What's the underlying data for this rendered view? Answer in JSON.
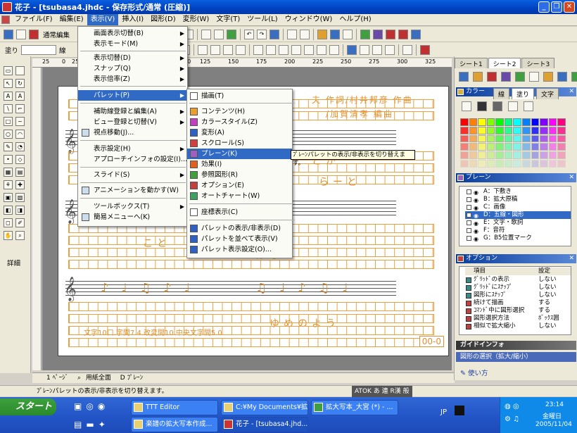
{
  "window": {
    "title": "花子 - [tsubasa4.jhdc - 保存形式/通常 (圧縮)]"
  },
  "menubar": [
    "ファイル(F)",
    "編集(E)",
    "表示(V)",
    "挿入(I)",
    "図形(D)",
    "変形(W)",
    "文字(T)",
    "ツール(L)",
    "ウィンドウ(W)",
    "ヘルプ(H)"
  ],
  "toolbar2": {
    "mode_label": "通常編集",
    "fill_label": "塗り",
    "line_label": "線"
  },
  "view_menu": [
    {
      "label": "画面表示切替(B)",
      "sub": true
    },
    {
      "label": "表示モード(M)",
      "sub": true
    },
    {
      "label": "表示切替(D)",
      "sub": true
    },
    {
      "label": "スナップ(Q)",
      "sub": true
    },
    {
      "label": "表示倍率(Z)",
      "sub": true
    },
    {
      "label": "パレット(P)",
      "sub": true
    },
    {
      "label": "補助線登録と編集(A)",
      "sub": true
    },
    {
      "label": "ビュー登録と切替(V)",
      "sub": true
    },
    {
      "label": "視点移動(J)..."
    },
    {
      "label": "表示設定(H)",
      "sub": true
    },
    {
      "label": "アプローチインフォの設定(I)..."
    },
    {
      "label": "スライド(S)",
      "sub": true
    },
    {
      "label": "アニメーションを動かす(W)"
    },
    {
      "label": "ツールボックス(T)",
      "sub": true
    },
    {
      "label": "簡易メニューへ(K)"
    }
  ],
  "palette_submenu": [
    "描画(T)",
    "コンテンツ(H)",
    "カラースタイル(Z)",
    "変形(A)",
    "スクロール(S)",
    "プレーン(K)",
    "効果(I)",
    "参照図形(R)",
    "オプション(E)",
    "オートチャート(W)",
    "座標表示(C)",
    "パレットの表示/非表示(D)",
    "パレットを並べて表示(V)",
    "パレット表示設定(O)..."
  ],
  "tooltip": "ﾌﾟﾚｰﾝパレットの表示/非表示を切り替えます。",
  "rulers": {
    "top_ticks": [
      "25",
      "0",
      "25",
      "100",
      "125",
      "150",
      "175",
      "200",
      "225",
      "250",
      "275",
      "300",
      "325"
    ]
  },
  "document": {
    "header_text": "夫 作詞/村井邦彦 作曲",
    "header_text2": "/加賀清孝 編曲",
    "page_label": "00-0",
    "footer_info": "文字10口.字間7.4.改変間10.中央文字間5.0",
    "lyrics": [
      "とが",
      "らーと",
      "こと",
      "ほら",
      "けて",
      "ゆめのよう"
    ]
  },
  "right_panel": {
    "tabs": [
      "シート1",
      "シート2",
      "シート3"
    ],
    "color_title": "カラー",
    "color_tabs": [
      "線",
      "塗り",
      "文字"
    ],
    "plane_title": "プレーン",
    "planes": [
      {
        "label": "A：下敷き",
        "selected": false
      },
      {
        "label": "B：拡大原稿",
        "selected": false
      },
      {
        "label": "C：画像",
        "selected": false
      },
      {
        "label": "D：五線・図形",
        "selected": true
      },
      {
        "label": "E：文字・歌詞",
        "selected": false
      },
      {
        "label": "F：音符",
        "selected": false
      },
      {
        "label": "G：B5位置マーク",
        "selected": false
      }
    ],
    "option_title": "オプション",
    "option_headers": [
      "項目",
      "設定"
    ],
    "options": [
      {
        "name": "ｸﾞﾘｯﾄﾞの表示",
        "value": "しない"
      },
      {
        "name": "ｸﾞﾘｯﾄﾞにｽﾅｯﾌﾟ",
        "value": "しない"
      },
      {
        "name": "図形にｽﾅｯﾌﾟ",
        "value": "しない"
      },
      {
        "name": "続けて描画",
        "value": "する"
      },
      {
        "name": "ｺﾏﾝﾄﾞ中に図形選択",
        "value": "する"
      },
      {
        "name": "図形選択方法",
        "value": "ﾎﾞｯｸｽ囲"
      },
      {
        "name": "相似で拡大縮小",
        "value": "しない"
      }
    ],
    "guide_title": "ガイドインフォ",
    "guide_item": "図形の選択（拡大/縮小）",
    "guide_link": "使い方"
  },
  "pagebar": {
    "page": "1 ﾍﾟｰｼﾞ",
    "view": "用紙全面",
    "plane": "D ﾌﾟﾚｰﾝ"
  },
  "statusbar": {
    "text": "ﾌﾟﾚｰﾝパレットの表示/非表示を切り替えます。",
    "ime": "ATOK あ 連 R漢 般"
  },
  "lefttools": {
    "detail": "詳細"
  },
  "taskbar": {
    "start": "スタート",
    "items": [
      {
        "label": "TTT Editor",
        "active": false
      },
      {
        "label": "C:¥My Documents¥拡...",
        "active": false
      },
      {
        "label": "拡大写本_大宮 (*) - ...",
        "active": false
      },
      {
        "label": "楽譜の拡大写本作成...",
        "active": false
      },
      {
        "label": "花子 - [tsubasa4.jhd...",
        "active": true
      }
    ],
    "lang": "JP",
    "clock": {
      "time": "23:14",
      "day": "金曜日",
      "date": "2005/11/04"
    }
  }
}
